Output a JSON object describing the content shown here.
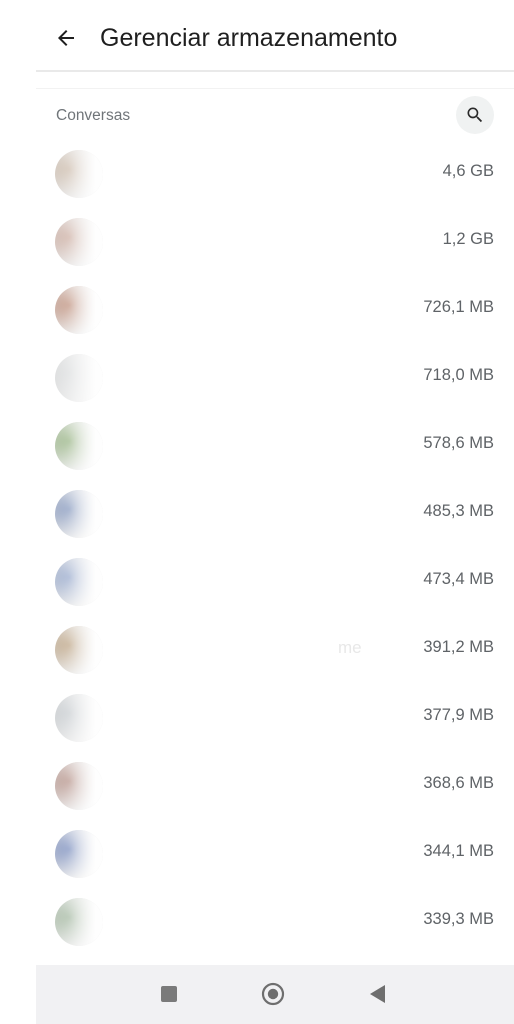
{
  "header": {
    "title": "Gerenciar armazenamento",
    "back_icon": "arrow-back-icon"
  },
  "section": {
    "label": "Conversas",
    "search_icon": "search-icon"
  },
  "chats": [
    {
      "name": "",
      "size": "4,6 GB",
      "avatar_color": "#c9b7a6"
    },
    {
      "name": "",
      "size": "1,2 GB",
      "avatar_color": "#c8a79a"
    },
    {
      "name": "",
      "size": "726,1 MB",
      "avatar_color": "#b98772"
    },
    {
      "name": "",
      "size": "718,0 MB",
      "avatar_color": "#d9dbdc"
    },
    {
      "name": "",
      "size": "578,6 MB",
      "avatar_color": "#8fae7a"
    },
    {
      "name": "",
      "size": "485,3 MB",
      "avatar_color": "#7b8fb8"
    },
    {
      "name": "",
      "size": "473,4 MB",
      "avatar_color": "#8fa2c8"
    },
    {
      "name": "me",
      "size": "391,2 MB",
      "avatar_color": "#b79c7a"
    },
    {
      "name": "",
      "size": "377,9 MB",
      "avatar_color": "#c3c8cc"
    },
    {
      "name": "",
      "size": "368,6 MB",
      "avatar_color": "#b08a80"
    },
    {
      "name": "",
      "size": "344,1 MB",
      "avatar_color": "#6f84b8"
    },
    {
      "name": "",
      "size": "339,3 MB",
      "avatar_color": "#9db39a"
    }
  ],
  "navbar": {
    "recents_icon": "square-recents-icon",
    "home_icon": "circle-home-icon",
    "back_icon": "triangle-back-icon"
  }
}
